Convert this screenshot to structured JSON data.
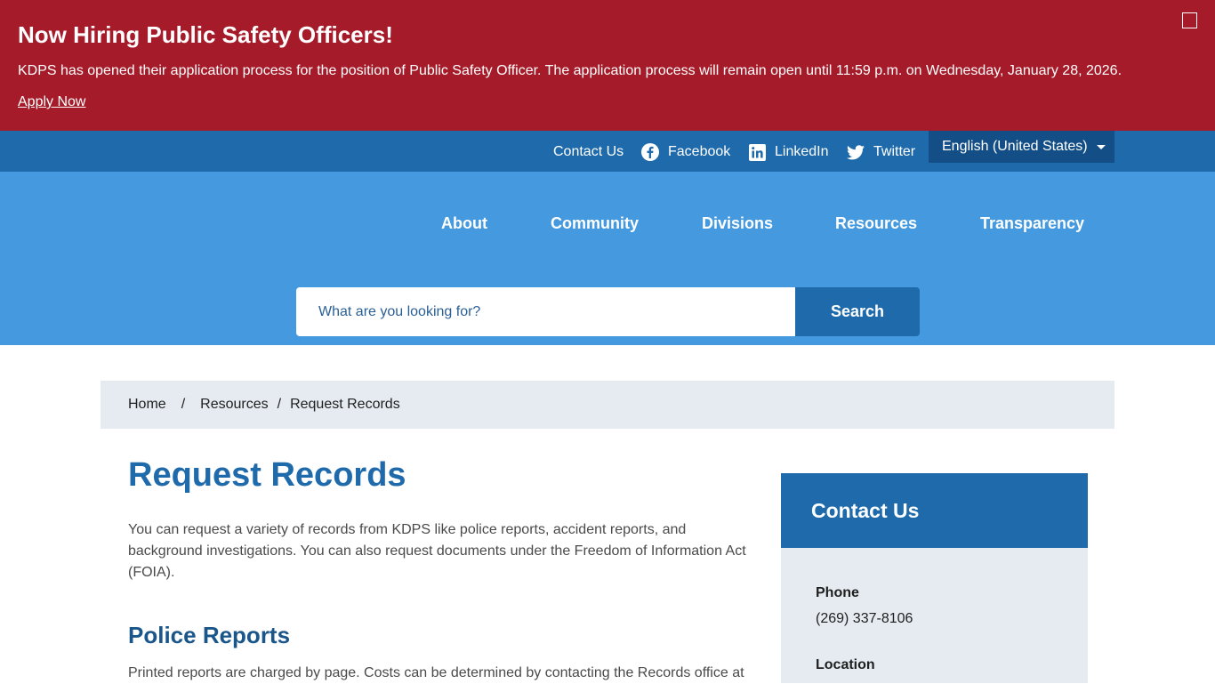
{
  "alert": {
    "title": "Now Hiring Public Safety Officers!",
    "body": "KDPS has opened their application process for the position of Public Safety Officer. The application process will remain open until 11:59 p.m. on Wednesday, January 28, 2026.",
    "link_label": "Apply Now",
    "close_icon": "close-icon"
  },
  "utility": {
    "contact": "Contact Us",
    "facebook": "Facebook",
    "linkedin": "LinkedIn",
    "twitter": "Twitter",
    "language": "English (United States)"
  },
  "nav": {
    "items": [
      "About",
      "Community",
      "Divisions",
      "Resources",
      "Transparency"
    ]
  },
  "search": {
    "placeholder": "What are you looking for?",
    "button": "Search"
  },
  "breadcrumb": {
    "home": "Home",
    "resources": "Resources",
    "current": "Request Records",
    "separator": "/"
  },
  "main": {
    "title": "Request Records",
    "intro": "You can request a variety of records from KDPS like police reports, accident reports, and background investigations. You can also request documents under the Freedom of Information Act (FOIA).",
    "section_title": "Police Reports",
    "section_body": "Printed reports are charged by page. Costs can be determined by contacting the Records office at"
  },
  "sidebar": {
    "title": "Contact Us",
    "phone_label": "Phone",
    "phone_value": "(269) 337-8106",
    "location_label": "Location"
  },
  "colors": {
    "alert_red": "#a61b29",
    "primary_blue": "#1e6aab",
    "nav_blue": "#4499df",
    "light_gray": "#e5ebf1"
  }
}
